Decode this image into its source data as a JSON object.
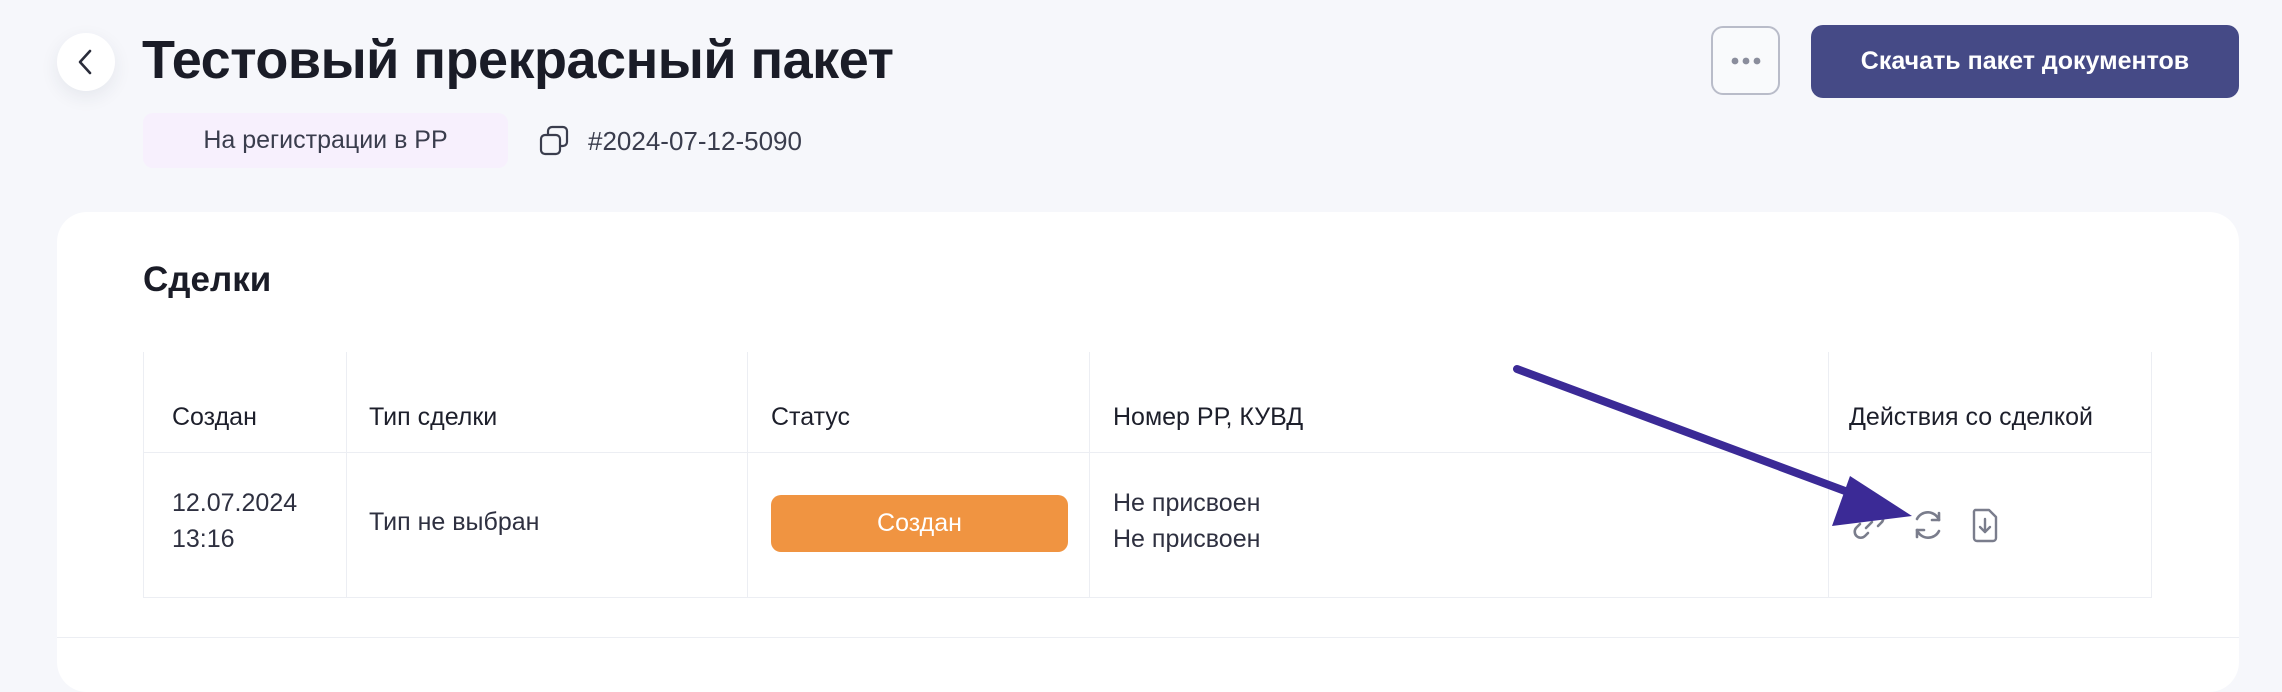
{
  "header": {
    "title": "Тестовый прекрасный пакет",
    "status_chip": "На регистрации в РР",
    "package_id": "#2024-07-12-5090",
    "more_icon": "ellipsis-icon",
    "download_label": "Скачать пакет документов"
  },
  "deals": {
    "title": "Сделки",
    "columns": [
      "Создан",
      "Тип сделки",
      "Статус",
      "Номер РР, КУВД",
      "Действия со сделкой"
    ],
    "rows": [
      {
        "created_date": "12.07.2024",
        "created_time": "13:16",
        "deal_type": "Тип не выбран",
        "status": "Создан",
        "rr_number": "Не присвоен",
        "kuvd_number": "Не присвоен",
        "actions": [
          "link-icon",
          "refresh-icon",
          "download-document-icon"
        ]
      }
    ]
  },
  "colors": {
    "background": "#f6f7fb",
    "primary_button": "#454a86",
    "status_chip_bg": "#f7f0fd",
    "status_badge": "#f09441",
    "annotation_arrow": "#3b2a96"
  }
}
